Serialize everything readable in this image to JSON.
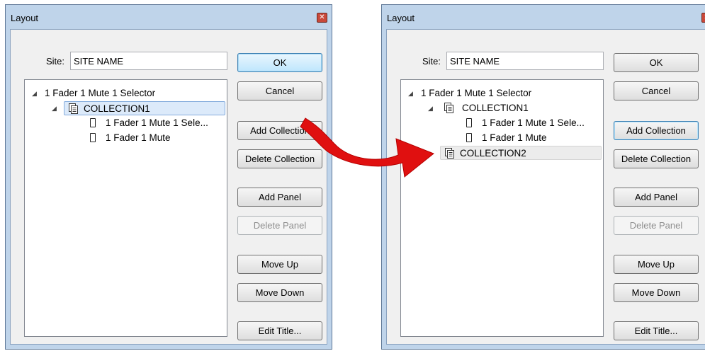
{
  "left_dialog": {
    "title": "Layout",
    "close_glyph": "✕",
    "site_label": "Site:",
    "site_value": "SITE NAME",
    "tree": {
      "root": {
        "expander": "◢",
        "label": "1 Fader 1 Mute 1 Selector"
      },
      "collection1": {
        "expander": "◢",
        "label": "COLLECTION1",
        "selected": true
      },
      "panel1": {
        "label": "1 Fader 1 Mute 1 Sele..."
      },
      "panel2": {
        "label": "1 Fader 1 Mute"
      }
    },
    "buttons": {
      "ok": "OK",
      "cancel": "Cancel",
      "add_collection": "Add Collection",
      "delete_collection": "Delete Collection",
      "add_panel": "Add Panel",
      "delete_panel": "Delete Panel",
      "move_up": "Move Up",
      "move_down": "Move Down",
      "edit_title": "Edit Title..."
    }
  },
  "right_dialog": {
    "title": "Layout",
    "close_glyph": "✕",
    "site_label": "Site:",
    "site_value": "SITE NAME",
    "tree": {
      "root": {
        "expander": "◢",
        "label": "1 Fader 1 Mute 1 Selector"
      },
      "collection1": {
        "expander": "◢",
        "label": "COLLECTION1"
      },
      "panel1": {
        "label": "1 Fader 1 Mute 1 Sele..."
      },
      "panel2": {
        "label": "1 Fader 1 Mute"
      },
      "collection2": {
        "label": "COLLECTION2"
      }
    },
    "buttons": {
      "ok": "OK",
      "cancel": "Cancel",
      "add_collection": "Add Collection",
      "delete_collection": "Delete Collection",
      "add_panel": "Add Panel",
      "delete_panel": "Delete Panel",
      "move_up": "Move Up",
      "move_down": "Move Down",
      "edit_title": "Edit Title..."
    }
  },
  "icons": {
    "collection": "collection-icon",
    "panel": "panel-icon",
    "expander": "expanded-triangle-icon",
    "close": "close-icon",
    "arrow": "red-arrow-icon"
  },
  "colors": {
    "frame": "#bfd4ea",
    "client": "#f0f0f0",
    "selection": "#dceafa",
    "arrow": "#e01010",
    "close": "#c9483a"
  }
}
